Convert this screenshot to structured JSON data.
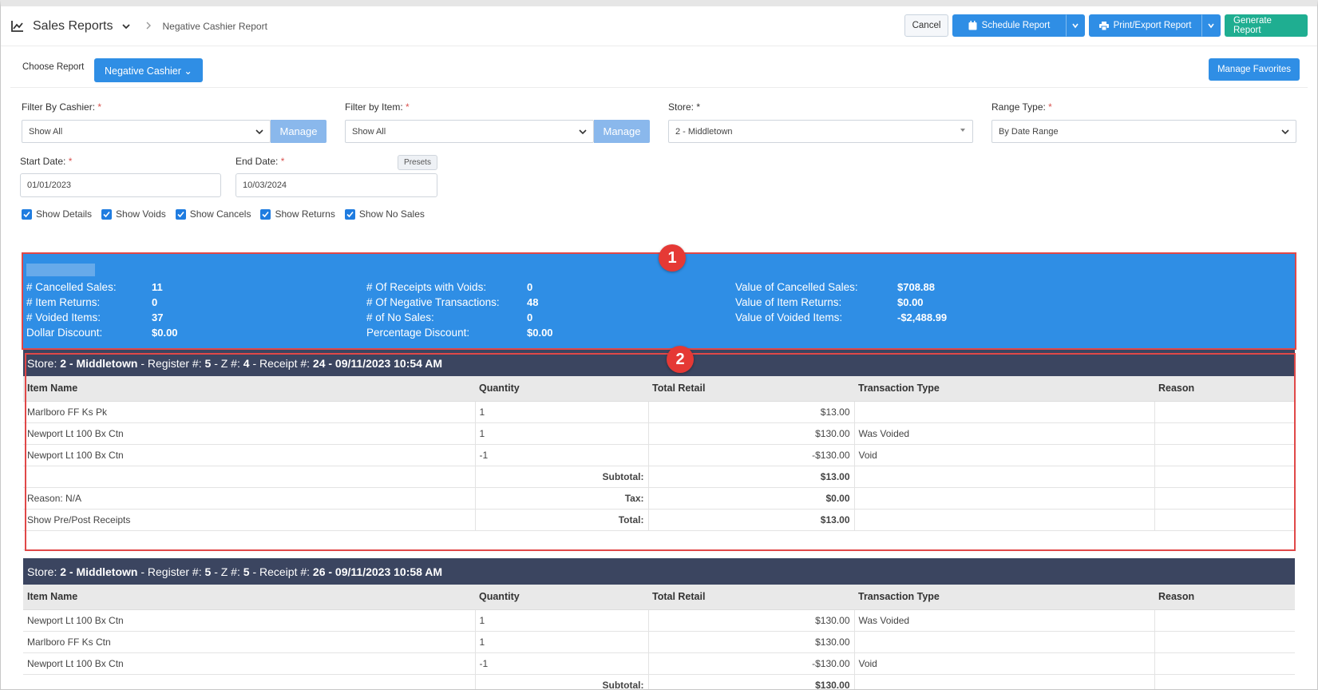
{
  "header": {
    "title": "Sales Reports",
    "subtitle": "Negative Cashier Report",
    "cancel": "Cancel",
    "schedule": "Schedule Report",
    "print_export": "Print/Export Report",
    "generate": "Generate Report"
  },
  "choose": {
    "label": "Choose Report",
    "value": "Negative Cashier ⌄",
    "manage_favorites": "Manage Favorites"
  },
  "filters": {
    "cashier_label": "Filter By Cashier:",
    "cashier_value": "Show All",
    "item_label": "Filter by Item:",
    "item_value": "Show All",
    "manage": "Manage",
    "store_label": "Store:",
    "store_value": "2 - Middletown",
    "range_label": "Range Type:",
    "range_value": "By Date Range",
    "start_label": "Start Date:",
    "start_value": "01/01/2023",
    "end_label": "End Date:",
    "end_value": "10/03/2024",
    "presets": "Presets",
    "req": "*",
    "checks": [
      "Show Details",
      "Show Voids",
      "Show Cancels",
      "Show Returns",
      "Show No Sales"
    ]
  },
  "summary": {
    "col1": [
      {
        "k": "# Cancelled Sales:",
        "v": "11"
      },
      {
        "k": "# Item Returns:",
        "v": "0"
      },
      {
        "k": "# Voided Items:",
        "v": "37"
      },
      {
        "k": "Dollar Discount:",
        "v": "$0.00"
      }
    ],
    "col2": [
      {
        "k": "# Of Receipts with Voids:",
        "v": "0"
      },
      {
        "k": "# Of Negative Transactions:",
        "v": "48"
      },
      {
        "k": "# of No Sales:",
        "v": "0"
      },
      {
        "k": "Percentage Discount:",
        "v": "$0.00"
      }
    ],
    "col3": [
      {
        "k": "Value of Cancelled Sales:",
        "v": "$708.88"
      },
      {
        "k": "Value of Item Returns:",
        "v": "$0.00"
      },
      {
        "k": "Value of Voided Items:",
        "v": "-$2,488.99"
      }
    ]
  },
  "annotations": {
    "one": "1",
    "two": "2"
  },
  "columns": {
    "item": "Item Name",
    "qty": "Quantity",
    "total": "Total Retail",
    "type": "Transaction Type",
    "reason": "Reason"
  },
  "receipts": [
    {
      "header": {
        "store_k": "Store:",
        "store_v": "2 - Middletown",
        "reg_k": "- Register #:",
        "reg_v": "5",
        "z_k": "- Z #:",
        "z_v": "4",
        "rec_k": "- Receipt #:",
        "rec_v": "24 - 09/11/2023 10:54 AM"
      },
      "rows": [
        {
          "item": "Marlboro FF Ks Pk",
          "qty": "1",
          "total": "$13.00",
          "type": ""
        },
        {
          "item": "Newport Lt 100 Bx Ctn",
          "qty": "1",
          "total": "$130.00",
          "type": "Was Voided"
        },
        {
          "item": "Newport Lt 100 Bx Ctn",
          "qty": "-1",
          "total": "-$130.00",
          "type": "Void"
        }
      ],
      "subtotal_label": "Subtotal:",
      "subtotal": "$13.00",
      "reason_line": "Reason: N/A",
      "tax_label": "Tax:",
      "tax": "$0.00",
      "link": "Show Pre/Post Receipts",
      "total_label": "Total:",
      "total": "$13.00"
    },
    {
      "header": {
        "store_k": "Store:",
        "store_v": "2 - Middletown",
        "reg_k": "- Register #:",
        "reg_v": "5",
        "z_k": "- Z #:",
        "z_v": "5",
        "rec_k": "- Receipt #:",
        "rec_v": "26 - 09/11/2023 10:58 AM"
      },
      "rows": [
        {
          "item": "Newport Lt 100 Bx Ctn",
          "qty": "1",
          "total": "$130.00",
          "type": "Was Voided"
        },
        {
          "item": "Marlboro FF Ks Ctn",
          "qty": "1",
          "total": "$130.00",
          "type": ""
        },
        {
          "item": "Newport Lt 100 Bx Ctn",
          "qty": "-1",
          "total": "-$130.00",
          "type": "Void"
        }
      ],
      "subtotal_label": "Subtotal:",
      "subtotal": "$130.00"
    }
  ]
}
